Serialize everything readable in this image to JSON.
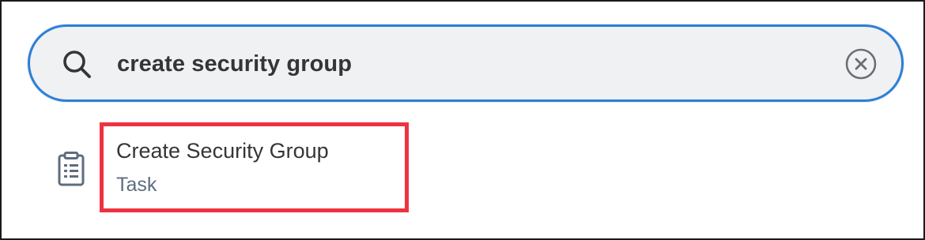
{
  "search": {
    "value": "create security group",
    "icon": "search-icon",
    "clear_icon": "close-circle-icon"
  },
  "results": [
    {
      "title": "Create Security Group",
      "type": "Task",
      "icon": "clipboard-icon",
      "highlighted": true
    }
  ],
  "colors": {
    "focus_border": "#2e7fd4",
    "highlight_border": "#ee3340",
    "search_background": "#f0f1f2",
    "primary_text": "#333537",
    "secondary_text": "#5f6d7e"
  }
}
